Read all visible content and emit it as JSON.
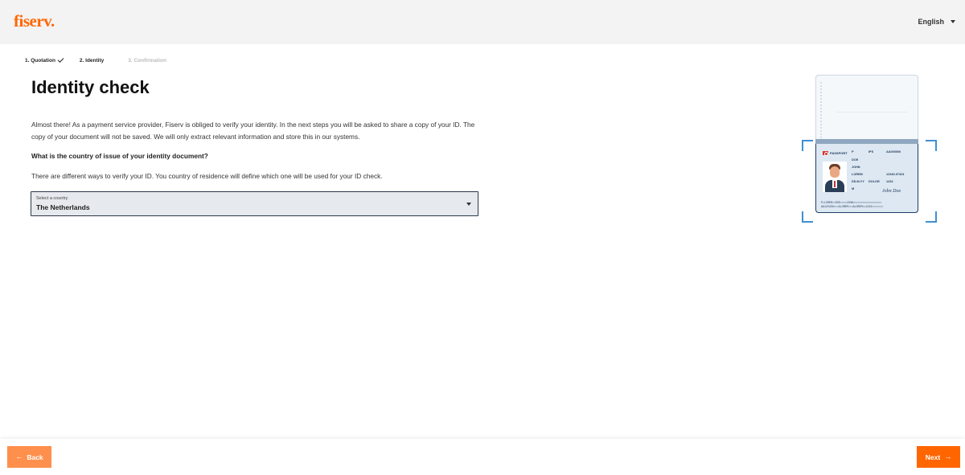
{
  "header": {
    "logo": "fiserv.",
    "language": "English"
  },
  "steps": [
    {
      "label": "1. Quotation",
      "state": "done"
    },
    {
      "label": "2. Identity",
      "state": "active"
    },
    {
      "label": "3. Confirmation",
      "state": "pending"
    }
  ],
  "main": {
    "title": "Identity check",
    "intro": "Almost there! As a payment service provider, Fiserv is obliged to verify your identity. In the next steps you will be asked to share a copy of your ID. The copy of your document will not be saved. We will only extract relevant information and store this in our systems.",
    "question": "What is the country of issue of your identity document?",
    "hint": "There are different ways to verify your ID. You country of residence will define which one will be used for your ID check.",
    "country_select": {
      "label": "Select a country",
      "value": "The Netherlands"
    }
  },
  "illustration": {
    "passport_label": "PASSPORT",
    "fields": [
      "P",
      "IPS",
      "AA000000",
      "DOE",
      "JOHN",
      "LOREM",
      "12340-07324",
      "DD.M.YY",
      "DOLOR",
      "1234",
      "M"
    ],
    "signature": "John Doe",
    "mrz_line1": "P<LOREM<<DOE<<<<JOHN<<<<<<<<<<<<<<<<<<",
    "mrz_line2": "AA123456<<<ALOREM<<<ALOREM<<1234<<<<<<<"
  },
  "footer": {
    "back_label": "Back",
    "next_label": "Next"
  },
  "colors": {
    "brand": "#ff6600",
    "back_button": "#ff8f4d",
    "scan_frame": "#3f8fd2"
  }
}
